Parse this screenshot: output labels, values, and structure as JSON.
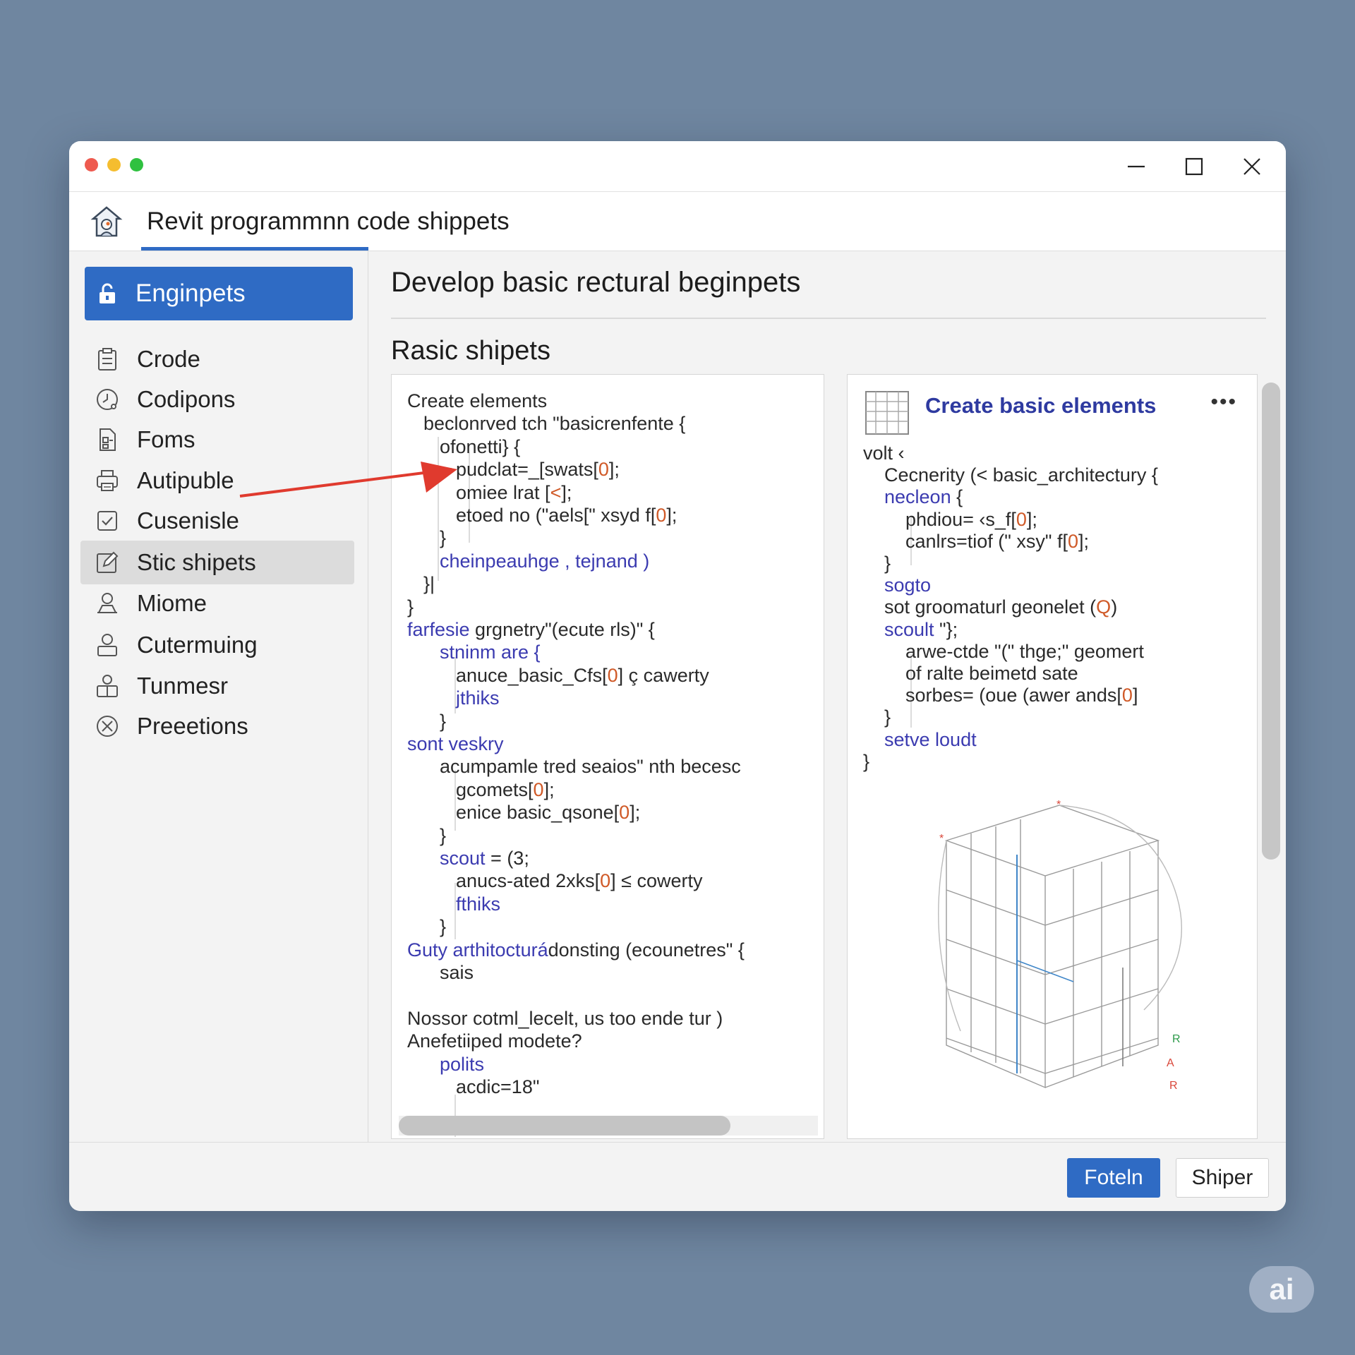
{
  "window": {
    "app_title": "Revit programmnn code shippets"
  },
  "sidebar": {
    "items": [
      {
        "label": "Enginpets",
        "icon": "unlock-icon",
        "active": true
      },
      {
        "label": "Crode",
        "icon": "clipboard-icon"
      },
      {
        "label": "Codipons",
        "icon": "clock-icon"
      },
      {
        "label": "Foms",
        "icon": "form-icon"
      },
      {
        "label": "Autipuble",
        "icon": "printer-icon"
      },
      {
        "label": "Cusenisle",
        "icon": "checkbox-icon"
      },
      {
        "label": "Stic shipets",
        "icon": "pen-square-icon",
        "highlighted": true
      },
      {
        "label": "Miome",
        "icon": "user-desk-icon"
      },
      {
        "label": "Cutermuing",
        "icon": "user-icon"
      },
      {
        "label": "Tunmesr",
        "icon": "users-icon"
      },
      {
        "label": "Preeetions",
        "icon": "cancel-circle-icon"
      }
    ]
  },
  "main": {
    "title": "Develop basic rectural beginpets",
    "section_title": "Rasic shipets",
    "left_code": [
      {
        "text": "Create elements",
        "indent": 0
      },
      {
        "text": "beclonrved tch \"basicrenfente {",
        "indent": 1
      },
      {
        "text": "ofonetti} {",
        "indent": 2
      },
      {
        "text": "pudclat=_[swats[",
        "num": "0",
        "tail": "];",
        "indent": 3
      },
      {
        "text": "omiee lrat [",
        "num": "<",
        "tail": "];",
        "indent": 3
      },
      {
        "text": "etoed no (\"aels[\" xsyd f[",
        "num": "0",
        "tail": "];",
        "indent": 3
      },
      {
        "text": "}",
        "indent": 2
      },
      {
        "text": "cheinpeauhge , tejnand )",
        "indent": 2,
        "kw": true
      },
      {
        "text": "}|",
        "indent": 1
      },
      {
        "text": "}",
        "indent": 0
      },
      {
        "text": "farfesie grgnetry\"(ecute rls)\" {",
        "indent": 0,
        "kw_prefix": "farfesie"
      },
      {
        "text": "stninm are {",
        "indent": 2,
        "kw": true
      },
      {
        "text": "anuce_basic_Cfs[",
        "num": "0",
        "tail": "] ç cawerty",
        "indent": 3
      },
      {
        "text": "jthiks",
        "indent": 3,
        "kw": true
      },
      {
        "text": "}",
        "indent": 2
      },
      {
        "text": "sont veskry",
        "indent": 0,
        "kw": true
      },
      {
        "text": "acumpamle tred seaios\" nth becesc",
        "indent": 2
      },
      {
        "text": "gcomets[",
        "num": "0",
        "tail": "];",
        "indent": 3
      },
      {
        "text": "enice basic_qsone[",
        "num": "0",
        "tail": "];",
        "indent": 3
      },
      {
        "text": "}",
        "indent": 2
      },
      {
        "text": "scout = (3;",
        "indent": 2,
        "kw_prefix": "scout"
      },
      {
        "text": "anucs-ated 2xks[",
        "num": "0",
        "tail": "] ≤ cowerty",
        "indent": 3
      },
      {
        "text": "fthiks",
        "indent": 3,
        "kw": true
      },
      {
        "text": "}",
        "indent": 2
      },
      {
        "text": "Guty arthitocturádonsting (ecounetres\" {",
        "indent": 0,
        "kw_prefix": "Guty arthitocturá"
      },
      {
        "text": "sais",
        "indent": 2
      },
      {
        "text": "",
        "indent": 0
      },
      {
        "text": "Nossor cotml_lecelt, us too ende tur )",
        "indent": 0
      },
      {
        "text": "Anefetiiped modete?",
        "indent": 0
      },
      {
        "text": "polits",
        "indent": 2,
        "kw": true
      },
      {
        "text": "acdic=18\"",
        "indent": 3
      }
    ],
    "card": {
      "title": "Create basic elements",
      "more_label": "•••",
      "code": [
        {
          "text": "volt ‹",
          "indent": 0
        },
        {
          "text": "Cecnerity (< basic_architectury {",
          "indent": 1
        },
        {
          "text": "necleon {",
          "indent": 1,
          "kw_prefix": "necleon"
        },
        {
          "text": "phdiou= ‹s_f[",
          "num": "0",
          "tail": "];",
          "indent": 2
        },
        {
          "text": "canlrs=tiof (\" xsy\" f[",
          "num": "0",
          "tail": "];",
          "indent": 2
        },
        {
          "text": "}",
          "indent": 1
        },
        {
          "text": "sogto",
          "indent": 1,
          "kw": true
        },
        {
          "text": "sot groomaturl geonelet (",
          "num": "Q",
          "tail": ")",
          "indent": 1
        },
        {
          "text": "scoult \"};",
          "indent": 1,
          "kw_prefix": "scoult"
        },
        {
          "text": "arwe-ctde \"(\" thge;\" geomert",
          "indent": 2
        },
        {
          "text": "of ralte beimetd sate",
          "indent": 2
        },
        {
          "text": "sorbes= (oue (awer ands[",
          "num": "0",
          "tail": "]",
          "indent": 2
        },
        {
          "text": "}",
          "indent": 1
        },
        {
          "text": "setve loudt",
          "indent": 1,
          "kw": true
        },
        {
          "text": "}",
          "indent": 0
        }
      ]
    }
  },
  "footer": {
    "primary_label": "Foteln",
    "secondary_label": "Shiper"
  },
  "watermark": "ai",
  "colors": {
    "accent": "#2f6bc4",
    "keyword": "#3b3bb0",
    "number": "#d05a28",
    "annotation_arrow": "#e03a2e"
  }
}
